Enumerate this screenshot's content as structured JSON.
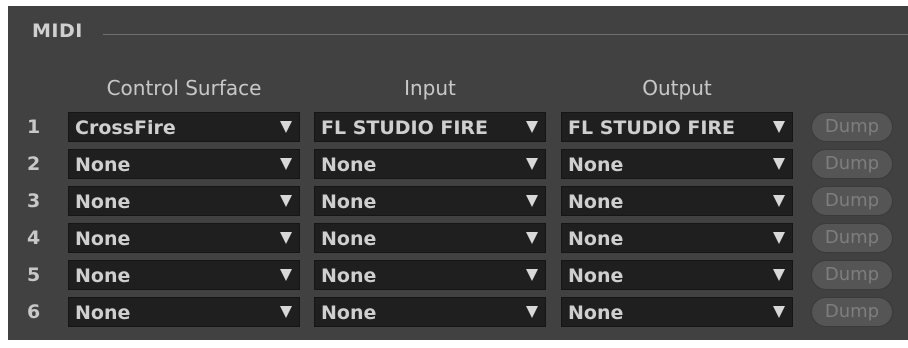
{
  "section": {
    "title": "MIDI"
  },
  "columns": {
    "control_surface": "Control Surface",
    "input": "Input",
    "output": "Output"
  },
  "rows": [
    {
      "number": "1",
      "control_surface": "CrossFire",
      "input": "FL STUDIO FIRE",
      "output": "FL STUDIO FIRE",
      "dump": "Dump"
    },
    {
      "number": "2",
      "control_surface": "None",
      "input": "None",
      "output": "None",
      "dump": "Dump"
    },
    {
      "number": "3",
      "control_surface": "None",
      "input": "None",
      "output": "None",
      "dump": "Dump"
    },
    {
      "number": "4",
      "control_surface": "None",
      "input": "None",
      "output": "None",
      "dump": "Dump"
    },
    {
      "number": "5",
      "control_surface": "None",
      "input": "None",
      "output": "None",
      "dump": "Dump"
    },
    {
      "number": "6",
      "control_surface": "None",
      "input": "None",
      "output": "None",
      "dump": "Dump"
    }
  ],
  "icons": {
    "dropdown_arrow": "triangle-down-icon"
  },
  "colors": {
    "panel_bg": "#414141",
    "dropdown_bg": "#1f1f1f",
    "text": "#cfcfcf",
    "dump_disabled": "#555555"
  }
}
